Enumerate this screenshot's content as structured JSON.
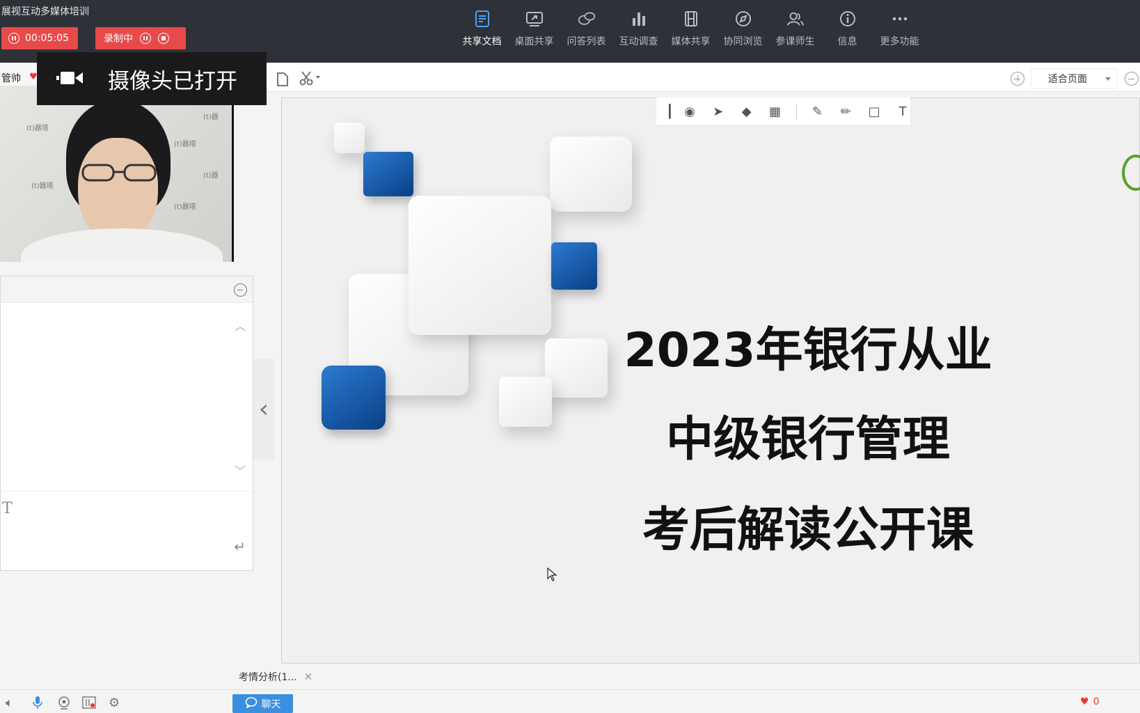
{
  "app": {
    "title": "展视互动多媒体培训",
    "timer": "00:05:05",
    "recording_label": "录制中"
  },
  "nav": [
    {
      "label": "共享文档",
      "icon": "document-icon",
      "active": true
    },
    {
      "label": "桌面共享",
      "icon": "desktop-share-icon",
      "active": false
    },
    {
      "label": "问答列表",
      "icon": "qa-icon",
      "active": false
    },
    {
      "label": "互动调查",
      "icon": "bar-chart-icon",
      "active": false
    },
    {
      "label": "媒体共享",
      "icon": "film-icon",
      "active": false
    },
    {
      "label": "协同浏览",
      "icon": "compass-icon",
      "active": false
    },
    {
      "label": "参课师生",
      "icon": "users-icon",
      "active": false
    },
    {
      "label": "信息",
      "icon": "info-icon",
      "active": false
    },
    {
      "label": "更多功能",
      "icon": "more-icon",
      "active": false
    }
  ],
  "camera_notice": "摄像头已打开",
  "teacher": {
    "name": "管帅"
  },
  "zoom": {
    "label": "适合页面"
  },
  "slide": {
    "line1": "2023年银行从业",
    "line2": "中级银行管理",
    "line3": "考后解读公开课"
  },
  "doc_tab": {
    "label": "考情分析(1..."
  },
  "chat_button": "聊天",
  "likes": "0",
  "colors": {
    "topbar": "#2e3138",
    "record_red": "#e84a4a",
    "accent_blue": "#3a8fe0",
    "slide_blue": "#1a5aa8"
  }
}
